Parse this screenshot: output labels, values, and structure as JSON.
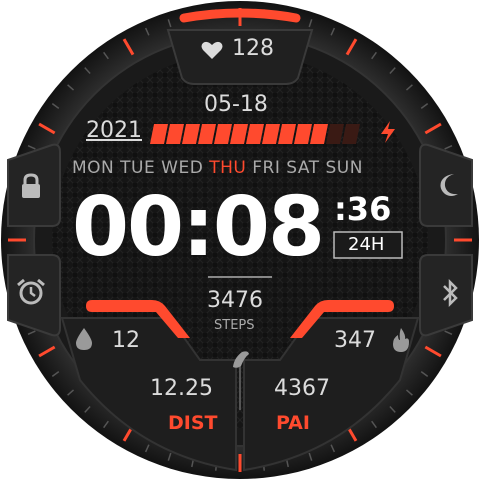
{
  "colors": {
    "accent": "#ff4a2e",
    "text": "#d8d8d8",
    "muted": "#9a9a9a",
    "bezel": "#2b2b2b",
    "panel": "#1c1c1c",
    "face": "#0e0e0e"
  },
  "top": {
    "icon": "heart-icon",
    "heart_rate": "128"
  },
  "date": {
    "month_day": "05-18",
    "year": "2021"
  },
  "battery": {
    "level": 0.85,
    "icon": "lightning-icon"
  },
  "weekdays": [
    "MON",
    "TUE",
    "WED",
    "THU",
    "FRI",
    "SAT",
    "SUN"
  ],
  "active_weekday": "THU",
  "time": {
    "hhmm": "00:08",
    "seconds": ":36",
    "format": "24H"
  },
  "steps": {
    "value": "3476",
    "label": "STEPS"
  },
  "left": {
    "icon": "water-drop-icon",
    "value": "12"
  },
  "right": {
    "icon": "flame-icon",
    "value": "347"
  },
  "bottom": {
    "dist_value": "12.25",
    "dist_label": "DIST",
    "pai_value": "4367",
    "pai_label": "PAI"
  },
  "side_icons": {
    "left_top": "lock-icon",
    "left_bottom": "alarm-icon",
    "right_top": "moon-icon",
    "right_bottom": "bluetooth-icon"
  }
}
